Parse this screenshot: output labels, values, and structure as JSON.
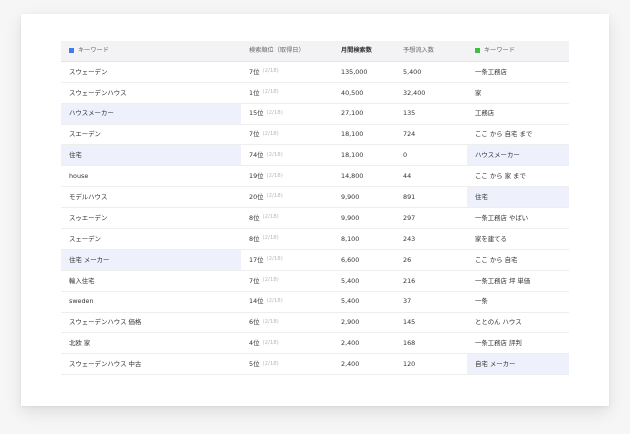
{
  "header": {
    "keyword_label": "キーワード",
    "rank_label": "検索順位（取得日）",
    "volume_label": "月間検索数",
    "traffic_label": "予想流入数",
    "related_label": "キーワード",
    "left_square_color": "#3d7cf0",
    "right_square_color": "#3fbf3f"
  },
  "rows": [
    {
      "keyword": "スウェーデン",
      "rank": "7位",
      "date": "(2/18)",
      "volume": "135,000",
      "traffic": "5,400",
      "related": "一条工務店",
      "hl_left": false,
      "hl_right": false
    },
    {
      "keyword": "スウェーデンハウス",
      "rank": "1位",
      "date": "(2/18)",
      "volume": "40,500",
      "traffic": "32,400",
      "related": "家",
      "hl_left": false,
      "hl_right": false
    },
    {
      "keyword": "ハウスメーカー",
      "rank": "15位",
      "date": "(2/18)",
      "volume": "27,100",
      "traffic": "135",
      "related": "工務店",
      "hl_left": true,
      "hl_right": false
    },
    {
      "keyword": "スエーデン",
      "rank": "7位",
      "date": "(2/18)",
      "volume": "18,100",
      "traffic": "724",
      "related": "ここ から 自宅 まで",
      "hl_left": false,
      "hl_right": false
    },
    {
      "keyword": "住宅",
      "rank": "74位",
      "date": "(2/18)",
      "volume": "18,100",
      "traffic": "0",
      "related": "ハウスメーカー",
      "hl_left": true,
      "hl_right": true
    },
    {
      "keyword": "house",
      "rank": "19位",
      "date": "(2/18)",
      "volume": "14,800",
      "traffic": "44",
      "related": "ここ から 家 まで",
      "hl_left": false,
      "hl_right": false
    },
    {
      "keyword": "モデルハウス",
      "rank": "20位",
      "date": "(2/18)",
      "volume": "9,900",
      "traffic": "891",
      "related": "住宅",
      "hl_left": false,
      "hl_right": true
    },
    {
      "keyword": "スゥエーデン",
      "rank": "8位",
      "date": "(2/18)",
      "volume": "9,900",
      "traffic": "297",
      "related": "一条工務店 やばい",
      "hl_left": false,
      "hl_right": false
    },
    {
      "keyword": "スェーデン",
      "rank": "8位",
      "date": "(2/18)",
      "volume": "8,100",
      "traffic": "243",
      "related": "家を建てる",
      "hl_left": false,
      "hl_right": false
    },
    {
      "keyword": "住宅 メーカー",
      "rank": "17位",
      "date": "(2/18)",
      "volume": "6,600",
      "traffic": "26",
      "related": "ここ から 自宅",
      "hl_left": true,
      "hl_right": false
    },
    {
      "keyword": "輸入住宅",
      "rank": "7位",
      "date": "(2/18)",
      "volume": "5,400",
      "traffic": "216",
      "related": "一条工務店 坪 単価",
      "hl_left": false,
      "hl_right": false
    },
    {
      "keyword": "sweden",
      "rank": "14位",
      "date": "(2/18)",
      "volume": "5,400",
      "traffic": "37",
      "related": "一条",
      "hl_left": false,
      "hl_right": false
    },
    {
      "keyword": "スウェーデンハウス 価格",
      "rank": "6位",
      "date": "(2/18)",
      "volume": "2,900",
      "traffic": "145",
      "related": "ととのん ハウス",
      "hl_left": false,
      "hl_right": false
    },
    {
      "keyword": "北欧 家",
      "rank": "4位",
      "date": "(2/18)",
      "volume": "2,400",
      "traffic": "168",
      "related": "一条工務店 評判",
      "hl_left": false,
      "hl_right": false
    },
    {
      "keyword": "スウェーデンハウス 中古",
      "rank": "5位",
      "date": "(2/18)",
      "volume": "2,400",
      "traffic": "120",
      "related": "自宅 メーカー",
      "hl_left": false,
      "hl_right": true
    }
  ]
}
